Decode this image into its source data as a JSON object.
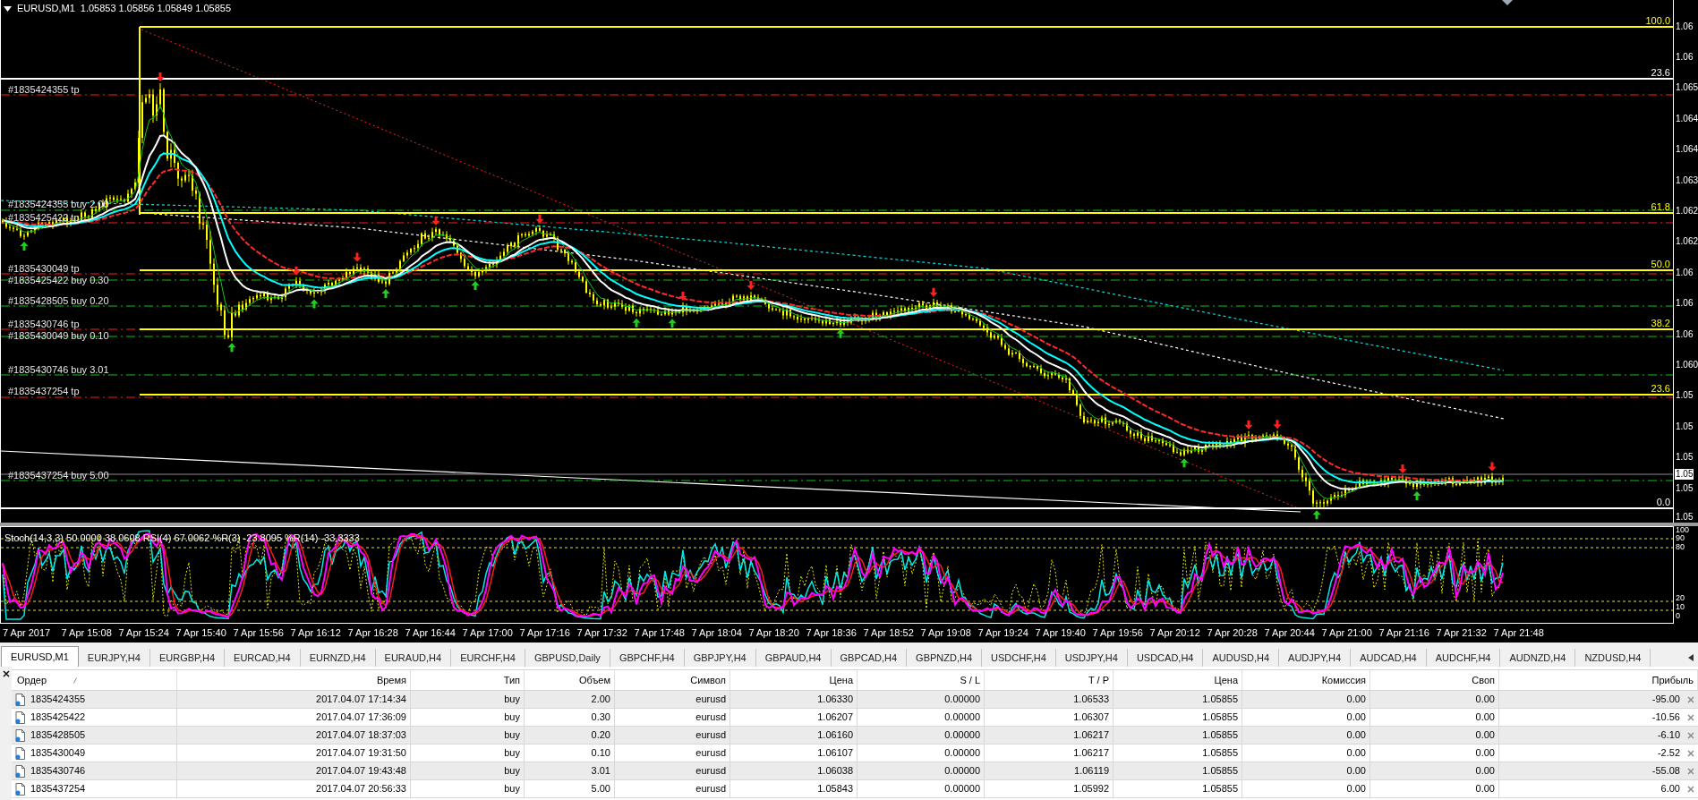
{
  "chart": {
    "title": "EURUSD,M1",
    "ohlc": "1.05853 1.05856 1.05849 1.05855",
    "order_lines": [
      {
        "label": "#1835424355 tp",
        "kind": "tp"
      },
      {
        "label": "#1835424355 buy 2.00",
        "kind": "buy"
      },
      {
        "label": "#1835425422 tp",
        "kind": "tp"
      },
      {
        "label": "#1835430049 tp",
        "kind": "tp"
      },
      {
        "label": "#1835425422 buy 0.30",
        "kind": "buy"
      },
      {
        "label": "#1835428505 buy 0.20",
        "kind": "buy"
      },
      {
        "label": "#1835430746 tp",
        "kind": "tp"
      },
      {
        "label": "#1835430049 buy 0.10",
        "kind": "buy"
      },
      {
        "label": "#1835430746 buy 3.01",
        "kind": "buy"
      },
      {
        "label": "#1835437254 tp",
        "kind": "tp"
      },
      {
        "label": "#1835437254 buy 5.00",
        "kind": "buy"
      }
    ],
    "fibonacci_levels": [
      {
        "label": "100.0",
        "color": "#ffff00"
      },
      {
        "label": "23.6",
        "color": "#ffffff"
      },
      {
        "label": "61.8",
        "color": "#ffff00"
      },
      {
        "label": "50.0",
        "color": "#ffff00"
      },
      {
        "label": "38.2",
        "color": "#ffff00"
      },
      {
        "label": "23.6",
        "color": "#ffff00"
      },
      {
        "label": "0.0",
        "color": "#ffffff"
      }
    ],
    "price_axis": [
      "1.06",
      "1.06",
      "1.065",
      "1.064",
      "1.064",
      "1.063",
      "1.062",
      "1.062",
      "1.06",
      "1.06",
      "1.06",
      "1.060",
      "1.05",
      "1.05",
      "1.05",
      "1.05",
      "1.05"
    ],
    "current_price": "1.05"
  },
  "indicator": {
    "label": "Stoch(14,3,3) 50.0000 38.0608 RSI(4) 67.0062 %R(3) -23.8095 %R(14) -33.3333",
    "levels": [
      "100",
      "90",
      "80",
      "20",
      "10",
      "0"
    ]
  },
  "time_axis": [
    "7 Apr 2017",
    "7 Apr 15:08",
    "7 Apr 15:24",
    "7 Apr 15:40",
    "7 Apr 15:56",
    "7 Apr 16:12",
    "7 Apr 16:28",
    "7 Apr 16:44",
    "7 Apr 17:00",
    "7 Apr 17:16",
    "7 Apr 17:32",
    "7 Apr 17:48",
    "7 Apr 18:04",
    "7 Apr 18:20",
    "7 Apr 18:36",
    "7 Apr 18:52",
    "7 Apr 19:08",
    "7 Apr 19:24",
    "7 Apr 19:40",
    "7 Apr 19:56",
    "7 Apr 20:12",
    "7 Apr 20:28",
    "7 Apr 20:44",
    "7 Apr 21:00",
    "7 Apr 21:16",
    "7 Apr 21:32",
    "7 Apr 21:48"
  ],
  "tabs": [
    {
      "label": "EURUSD,M1",
      "selected": true
    },
    {
      "label": "EURJPY,H4",
      "selected": false
    },
    {
      "label": "EURGBP,H4",
      "selected": false
    },
    {
      "label": "EURCAD,H4",
      "selected": false
    },
    {
      "label": "EURNZD,H4",
      "selected": false
    },
    {
      "label": "EURAUD,H4",
      "selected": false
    },
    {
      "label": "EURCHF,H4",
      "selected": false
    },
    {
      "label": "GBPUSD,Daily",
      "selected": false
    },
    {
      "label": "GBPCHF,H4",
      "selected": false
    },
    {
      "label": "GBPJPY,H4",
      "selected": false
    },
    {
      "label": "GBPAUD,H4",
      "selected": false
    },
    {
      "label": "GBPCAD,H4",
      "selected": false
    },
    {
      "label": "GBPNZD,H4",
      "selected": false
    },
    {
      "label": "USDCHF,H4",
      "selected": false
    },
    {
      "label": "USDJPY,H4",
      "selected": false
    },
    {
      "label": "USDCAD,H4",
      "selected": false
    },
    {
      "label": "AUDUSD,H4",
      "selected": false
    },
    {
      "label": "AUDJPY,H4",
      "selected": false
    },
    {
      "label": "AUDCAD,H4",
      "selected": false
    },
    {
      "label": "AUDCHF,H4",
      "selected": false
    },
    {
      "label": "AUDNZD,H4",
      "selected": false
    },
    {
      "label": "NZDUSD,H4",
      "selected": false
    }
  ],
  "table": {
    "columns": [
      "Ордер",
      "Время",
      "Тип",
      "Объем",
      "Символ",
      "Цена",
      "S / L",
      "T / P",
      "Цена",
      "Комиссия",
      "Своп",
      "Прибыль"
    ],
    "rows": [
      [
        "1835424355",
        "2017.04.07 17:14:34",
        "buy",
        "2.00",
        "eurusd",
        "1.06330",
        "0.00000",
        "1.06533",
        "1.05855",
        "0.00",
        "0.00",
        "-95.00"
      ],
      [
        "1835425422",
        "2017.04.07 17:36:09",
        "buy",
        "0.30",
        "eurusd",
        "1.06207",
        "0.00000",
        "1.06307",
        "1.05855",
        "0.00",
        "0.00",
        "-10.56"
      ],
      [
        "1835428505",
        "2017.04.07 18:37:03",
        "buy",
        "0.20",
        "eurusd",
        "1.06160",
        "0.00000",
        "1.06217",
        "1.05855",
        "0.00",
        "0.00",
        "-6.10"
      ],
      [
        "1835430049",
        "2017.04.07 19:31:50",
        "buy",
        "0.10",
        "eurusd",
        "1.06107",
        "0.00000",
        "1.06217",
        "1.05855",
        "0.00",
        "0.00",
        "-2.52"
      ],
      [
        "1835430746",
        "2017.04.07 19:43:48",
        "buy",
        "3.01",
        "eurusd",
        "1.06038",
        "0.00000",
        "1.06119",
        "1.05855",
        "0.00",
        "0.00",
        "-55.08"
      ],
      [
        "1835437254",
        "2017.04.07 20:56:33",
        "buy",
        "5.00",
        "eurusd",
        "1.05843",
        "0.00000",
        "1.05992",
        "1.05855",
        "0.00",
        "0.00",
        "6.00"
      ]
    ]
  }
}
